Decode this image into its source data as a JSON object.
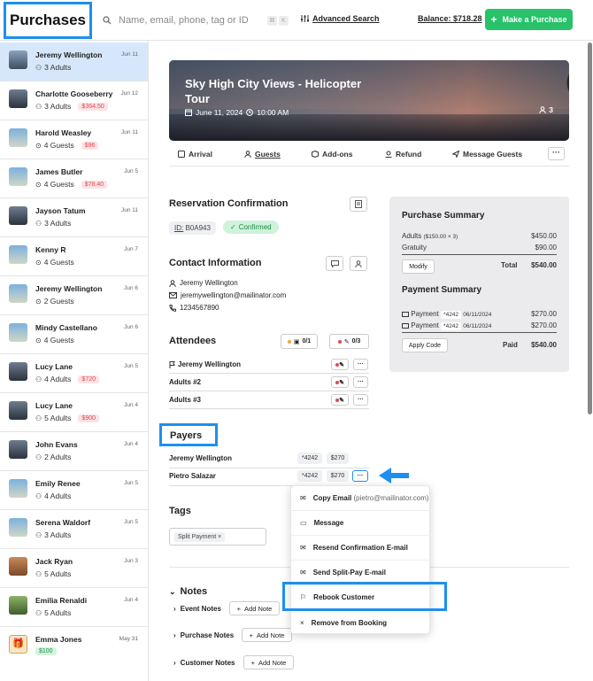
{
  "header": {
    "title": "Purchases",
    "search_placeholder": "Name, email, phone, tag or ID",
    "advanced_search": "Advanced Search",
    "balance": "Balance: $718.28",
    "make_purchase": "Make a Purchase"
  },
  "sidebar": {
    "items": [
      {
        "name": "Jeremy Wellington",
        "date": "Jun 11",
        "sub": "3 Adults",
        "badge": ""
      },
      {
        "name": "Charlotte Gooseberry",
        "date": "Jun 12",
        "sub": "3 Adults",
        "badge": "$364.50"
      },
      {
        "name": "Harold Weasley",
        "date": "Jun 11",
        "sub": "4 Guests",
        "badge": "$96"
      },
      {
        "name": "James Butler",
        "date": "Jun 5",
        "sub": "4 Guests",
        "badge": "$78.40"
      },
      {
        "name": "Jayson Tatum",
        "date": "Jun 11",
        "sub": "3 Adults",
        "badge": ""
      },
      {
        "name": "Kenny R",
        "date": "Jun 7",
        "sub": "4 Guests",
        "badge": ""
      },
      {
        "name": "Jeremy Wellington",
        "date": "Jun 6",
        "sub": "2 Guests",
        "badge": ""
      },
      {
        "name": "Mindy Castellano",
        "date": "Jun 6",
        "sub": "4 Guests",
        "badge": ""
      },
      {
        "name": "Lucy Lane",
        "date": "Jun 5",
        "sub": "4 Adults",
        "badge": "$720"
      },
      {
        "name": "Lucy Lane",
        "date": "Jun 4",
        "sub": "5 Adults",
        "badge": "$900"
      },
      {
        "name": "John Evans",
        "date": "Jun 4",
        "sub": "2 Adults",
        "badge": ""
      },
      {
        "name": "Emily Renee",
        "date": "Jun 5",
        "sub": "4 Adults",
        "badge": ""
      },
      {
        "name": "Serena Waldorf",
        "date": "Jun 5",
        "sub": "3 Adults",
        "badge": ""
      },
      {
        "name": "Jack Ryan",
        "date": "Jun 3",
        "sub": "5 Adults",
        "badge": ""
      },
      {
        "name": "Emilia Renaldi",
        "date": "Jun 4",
        "sub": "5 Adults",
        "badge": ""
      },
      {
        "name": "Emma Jones",
        "date": "May 31",
        "sub": "",
        "badge": "$100"
      }
    ]
  },
  "hero": {
    "title": "Sky High City Views - Helicopter Tour",
    "date": "June 11, 2024",
    "time": "10:00 AM",
    "count": "3"
  },
  "tabs": [
    "Arrival",
    "Guests",
    "Add-ons",
    "Refund",
    "Message Guests"
  ],
  "reservation": {
    "heading": "Reservation Confirmation",
    "id_label": "ID:",
    "id_value": "B0A943",
    "status": "Confirmed"
  },
  "contact": {
    "heading": "Contact Information",
    "name": "Jeremy Wellington",
    "email": "jeremywellington@mailinator.com",
    "phone": "1234567890"
  },
  "attendees": {
    "heading": "Attendees",
    "count1": "0/1",
    "count2": "0/3",
    "rows": [
      "Jeremy Wellington",
      "Adults #2",
      "Adults #3"
    ]
  },
  "payers": {
    "heading": "Payers",
    "rows": [
      {
        "name": "Jeremy Wellington",
        "card": "*4242",
        "amount": "$270"
      },
      {
        "name": "Pietro Salazar",
        "card": "*4242",
        "amount": "$270"
      }
    ]
  },
  "tags": {
    "heading": "Tags",
    "items": [
      "Split Payment"
    ]
  },
  "notes": {
    "heading": "Notes",
    "rows": [
      "Event Notes",
      "Purchase Notes",
      "Customer Notes"
    ],
    "add_label": "Add Note"
  },
  "purchase_summary": {
    "heading": "Purchase Summary",
    "adults_label": "Adults",
    "adults_detail": "($150.00 × 3)",
    "adults_amount": "$450.00",
    "gratuity_label": "Gratuity",
    "gratuity_amount": "$90.00",
    "modify": "Modify",
    "total_label": "Total",
    "total_amount": "$540.00"
  },
  "payment_summary": {
    "heading": "Payment Summary",
    "rows": [
      {
        "label": "Payment",
        "card": "*4242",
        "date": "06/11/2024",
        "amount": "$270.00"
      },
      {
        "label": "Payment",
        "card": "*4242",
        "date": "06/11/2024",
        "amount": "$270.00"
      }
    ],
    "apply_code": "Apply Code",
    "paid_label": "Paid",
    "paid_amount": "$540.00"
  },
  "menu": {
    "copy_email": "Copy Email",
    "copy_email_detail": "(pietro@mailinator.com)",
    "message": "Message",
    "resend": "Resend Confirmation E-mail",
    "split_pay": "Send Split-Pay E-mail",
    "rebook": "Rebook Customer",
    "remove": "Remove from Booking"
  },
  "colors": {
    "accent": "#1d8ff0",
    "green": "#27c26a",
    "active_row": "#d7e7fb",
    "badge_red": "#e0485a"
  }
}
